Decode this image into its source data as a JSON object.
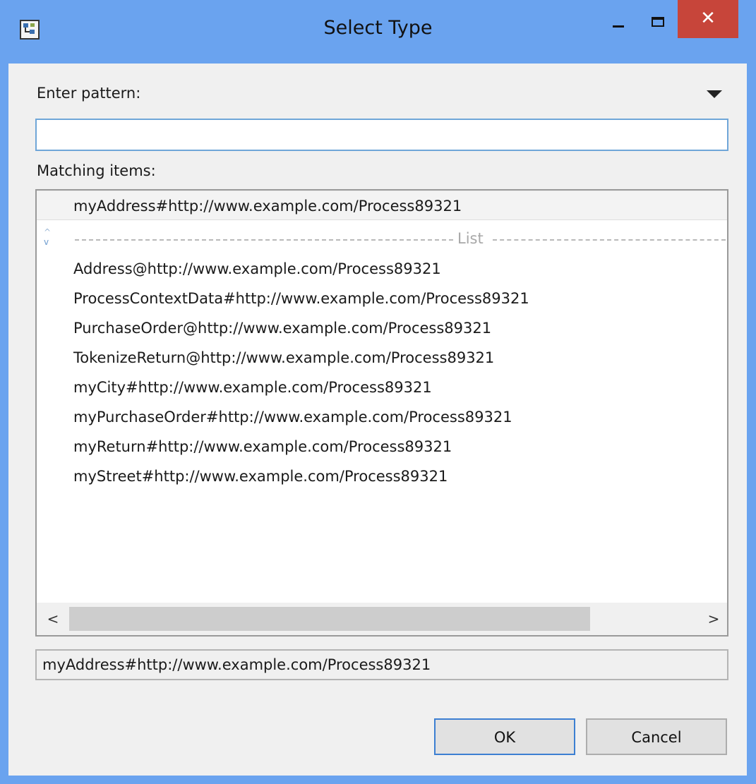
{
  "window": {
    "title": "Select Type",
    "close_glyph": "✕",
    "icons": {
      "app": "type-hierarchy-icon",
      "minimize": "minimize-icon",
      "maximize": "maximize-icon",
      "close": "close-icon"
    }
  },
  "pattern": {
    "label": "Enter pattern:",
    "value": "",
    "placeholder": "",
    "menu_icon": "dropdown-triangle-icon"
  },
  "matching": {
    "label": "Matching items:",
    "history_item": "myAddress#http://www.example.com/Process89321",
    "separator_label": "List",
    "items": [
      "Address@http://www.example.com/Process89321",
      "ProcessContextData#http://www.example.com/Process89321",
      "PurchaseOrder@http://www.example.com/Process89321",
      "TokenizeReturn@http://www.example.com/Process89321",
      "myCity#http://www.example.com/Process89321",
      "myPurchaseOrder#http://www.example.com/Process89321",
      "myReturn#http://www.example.com/Process89321",
      "myStreet#http://www.example.com/Process89321"
    ],
    "scroll_left_glyph": "<",
    "scroll_right_glyph": ">"
  },
  "status": {
    "text": "myAddress#http://www.example.com/Process89321"
  },
  "buttons": {
    "ok": "OK",
    "cancel": "Cancel"
  },
  "colors": {
    "title_bar": "#6aa3ef",
    "close_button": "#c7453a",
    "dialog_background": "#f0f0f0",
    "input_focus_border": "#6fa6d8"
  }
}
